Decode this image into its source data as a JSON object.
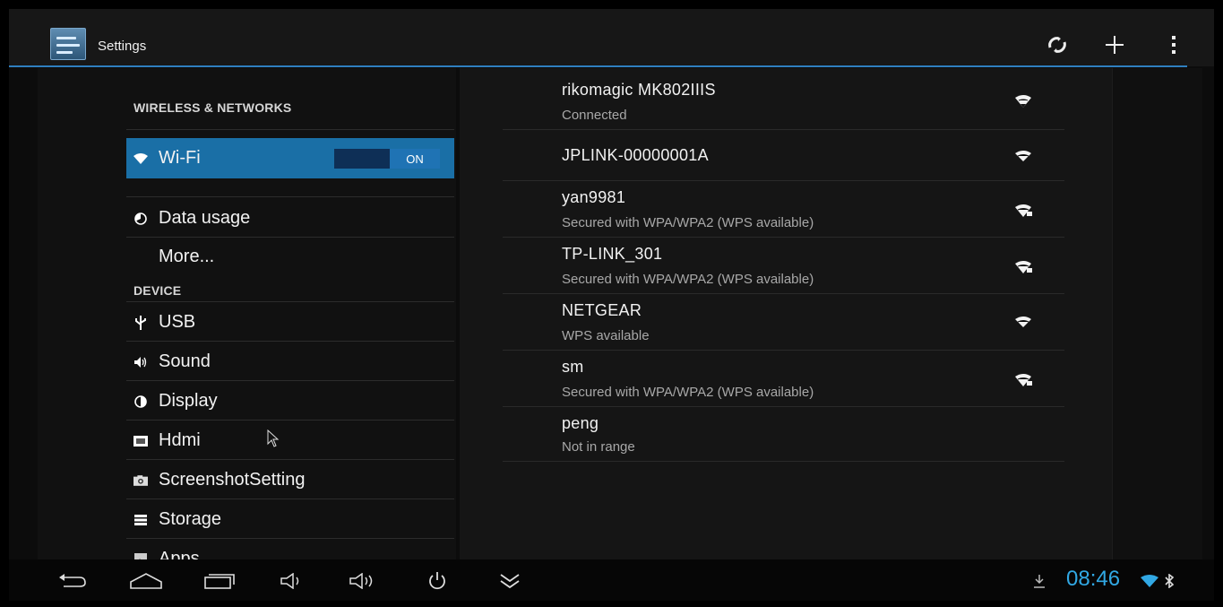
{
  "action_bar": {
    "title": "Settings",
    "app_icon": "settings-sliders-icon",
    "actions": [
      "scan-refresh-icon",
      "add-icon",
      "overflow-menu-icon"
    ]
  },
  "sidebar": {
    "sections": [
      {
        "header": "WIRELESS & NETWORKS"
      },
      {
        "header": "DEVICE"
      }
    ],
    "items": [
      {
        "label": "Wi-Fi",
        "icon": "wifi-icon",
        "selected": true,
        "toggle": "ON"
      },
      {
        "label": "Data usage",
        "icon": "data-usage-icon"
      },
      {
        "label": "More...",
        "icon": ""
      },
      {
        "label": "USB",
        "icon": "usb-icon"
      },
      {
        "label": "Sound",
        "icon": "sound-icon"
      },
      {
        "label": "Display",
        "icon": "display-icon"
      },
      {
        "label": "Hdmi",
        "icon": "hdmi-icon"
      },
      {
        "label": "ScreenshotSetting",
        "icon": "camera-icon"
      },
      {
        "label": "Storage",
        "icon": "storage-icon"
      },
      {
        "label": "Apps",
        "icon": "apps-icon"
      }
    ]
  },
  "networks": [
    {
      "name": "rikomagic MK802IIIS",
      "status": "Connected",
      "signal_icon": "wifi-signal-icon"
    },
    {
      "name": "JPLINK-00000001A",
      "status": "",
      "signal_icon": "wifi-signal-icon"
    },
    {
      "name": "yan9981",
      "status": "Secured with WPA/WPA2 (WPS available)",
      "signal_icon": "wifi-signal-locked-icon"
    },
    {
      "name": "TP-LINK_301",
      "status": "Secured with WPA/WPA2 (WPS available)",
      "signal_icon": "wifi-signal-locked-icon"
    },
    {
      "name": "NETGEAR",
      "status": "WPS available",
      "signal_icon": "wifi-signal-icon"
    },
    {
      "name": "sm",
      "status": "Secured with WPA/WPA2 (WPS available)",
      "signal_icon": "wifi-signal-locked-icon"
    },
    {
      "name": "peng",
      "status": "Not in range",
      "signal_icon": ""
    }
  ],
  "system_bar": {
    "buttons": [
      "back-icon",
      "home-icon",
      "recent-apps-icon",
      "volume-down-icon",
      "volume-up-icon",
      "power-icon",
      "collapse-icon"
    ],
    "time": "08:46",
    "status_icons": [
      "download-icon",
      "wifi-status-icon",
      "bluetooth-icon"
    ]
  },
  "colors": {
    "accent": "#2f7fbf",
    "selected_item": "#1a6fa6",
    "clock": "#31a8e4"
  }
}
